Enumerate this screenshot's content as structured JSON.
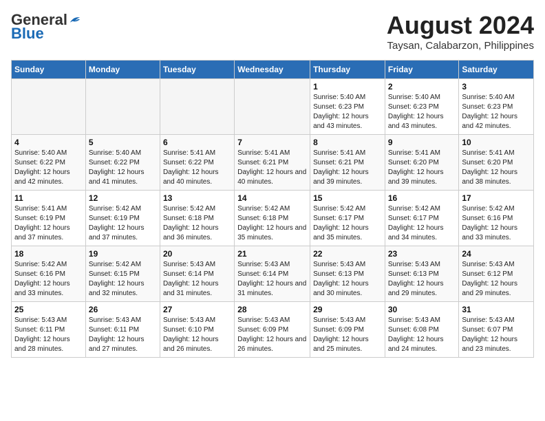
{
  "header": {
    "logo": {
      "general": "General",
      "blue": "Blue"
    },
    "title": "August 2024",
    "location": "Taysan, Calabarzon, Philippines"
  },
  "days_of_week": [
    "Sunday",
    "Monday",
    "Tuesday",
    "Wednesday",
    "Thursday",
    "Friday",
    "Saturday"
  ],
  "weeks": [
    [
      {
        "day": "",
        "empty": true
      },
      {
        "day": "",
        "empty": true
      },
      {
        "day": "",
        "empty": true
      },
      {
        "day": "",
        "empty": true
      },
      {
        "day": "1",
        "sunrise": "5:40 AM",
        "sunset": "6:23 PM",
        "daylight": "12 hours and 43 minutes."
      },
      {
        "day": "2",
        "sunrise": "5:40 AM",
        "sunset": "6:23 PM",
        "daylight": "12 hours and 43 minutes."
      },
      {
        "day": "3",
        "sunrise": "5:40 AM",
        "sunset": "6:23 PM",
        "daylight": "12 hours and 42 minutes."
      }
    ],
    [
      {
        "day": "4",
        "sunrise": "5:40 AM",
        "sunset": "6:22 PM",
        "daylight": "12 hours and 42 minutes."
      },
      {
        "day": "5",
        "sunrise": "5:40 AM",
        "sunset": "6:22 PM",
        "daylight": "12 hours and 41 minutes."
      },
      {
        "day": "6",
        "sunrise": "5:41 AM",
        "sunset": "6:22 PM",
        "daylight": "12 hours and 40 minutes."
      },
      {
        "day": "7",
        "sunrise": "5:41 AM",
        "sunset": "6:21 PM",
        "daylight": "12 hours and 40 minutes."
      },
      {
        "day": "8",
        "sunrise": "5:41 AM",
        "sunset": "6:21 PM",
        "daylight": "12 hours and 39 minutes."
      },
      {
        "day": "9",
        "sunrise": "5:41 AM",
        "sunset": "6:20 PM",
        "daylight": "12 hours and 39 minutes."
      },
      {
        "day": "10",
        "sunrise": "5:41 AM",
        "sunset": "6:20 PM",
        "daylight": "12 hours and 38 minutes."
      }
    ],
    [
      {
        "day": "11",
        "sunrise": "5:41 AM",
        "sunset": "6:19 PM",
        "daylight": "12 hours and 37 minutes."
      },
      {
        "day": "12",
        "sunrise": "5:42 AM",
        "sunset": "6:19 PM",
        "daylight": "12 hours and 37 minutes."
      },
      {
        "day": "13",
        "sunrise": "5:42 AM",
        "sunset": "6:18 PM",
        "daylight": "12 hours and 36 minutes."
      },
      {
        "day": "14",
        "sunrise": "5:42 AM",
        "sunset": "6:18 PM",
        "daylight": "12 hours and 35 minutes."
      },
      {
        "day": "15",
        "sunrise": "5:42 AM",
        "sunset": "6:17 PM",
        "daylight": "12 hours and 35 minutes."
      },
      {
        "day": "16",
        "sunrise": "5:42 AM",
        "sunset": "6:17 PM",
        "daylight": "12 hours and 34 minutes."
      },
      {
        "day": "17",
        "sunrise": "5:42 AM",
        "sunset": "6:16 PM",
        "daylight": "12 hours and 33 minutes."
      }
    ],
    [
      {
        "day": "18",
        "sunrise": "5:42 AM",
        "sunset": "6:16 PM",
        "daylight": "12 hours and 33 minutes."
      },
      {
        "day": "19",
        "sunrise": "5:42 AM",
        "sunset": "6:15 PM",
        "daylight": "12 hours and 32 minutes."
      },
      {
        "day": "20",
        "sunrise": "5:43 AM",
        "sunset": "6:14 PM",
        "daylight": "12 hours and 31 minutes."
      },
      {
        "day": "21",
        "sunrise": "5:43 AM",
        "sunset": "6:14 PM",
        "daylight": "12 hours and 31 minutes."
      },
      {
        "day": "22",
        "sunrise": "5:43 AM",
        "sunset": "6:13 PM",
        "daylight": "12 hours and 30 minutes."
      },
      {
        "day": "23",
        "sunrise": "5:43 AM",
        "sunset": "6:13 PM",
        "daylight": "12 hours and 29 minutes."
      },
      {
        "day": "24",
        "sunrise": "5:43 AM",
        "sunset": "6:12 PM",
        "daylight": "12 hours and 29 minutes."
      }
    ],
    [
      {
        "day": "25",
        "sunrise": "5:43 AM",
        "sunset": "6:11 PM",
        "daylight": "12 hours and 28 minutes."
      },
      {
        "day": "26",
        "sunrise": "5:43 AM",
        "sunset": "6:11 PM",
        "daylight": "12 hours and 27 minutes."
      },
      {
        "day": "27",
        "sunrise": "5:43 AM",
        "sunset": "6:10 PM",
        "daylight": "12 hours and 26 minutes."
      },
      {
        "day": "28",
        "sunrise": "5:43 AM",
        "sunset": "6:09 PM",
        "daylight": "12 hours and 26 minutes."
      },
      {
        "day": "29",
        "sunrise": "5:43 AM",
        "sunset": "6:09 PM",
        "daylight": "12 hours and 25 minutes."
      },
      {
        "day": "30",
        "sunrise": "5:43 AM",
        "sunset": "6:08 PM",
        "daylight": "12 hours and 24 minutes."
      },
      {
        "day": "31",
        "sunrise": "5:43 AM",
        "sunset": "6:07 PM",
        "daylight": "12 hours and 23 minutes."
      }
    ]
  ]
}
